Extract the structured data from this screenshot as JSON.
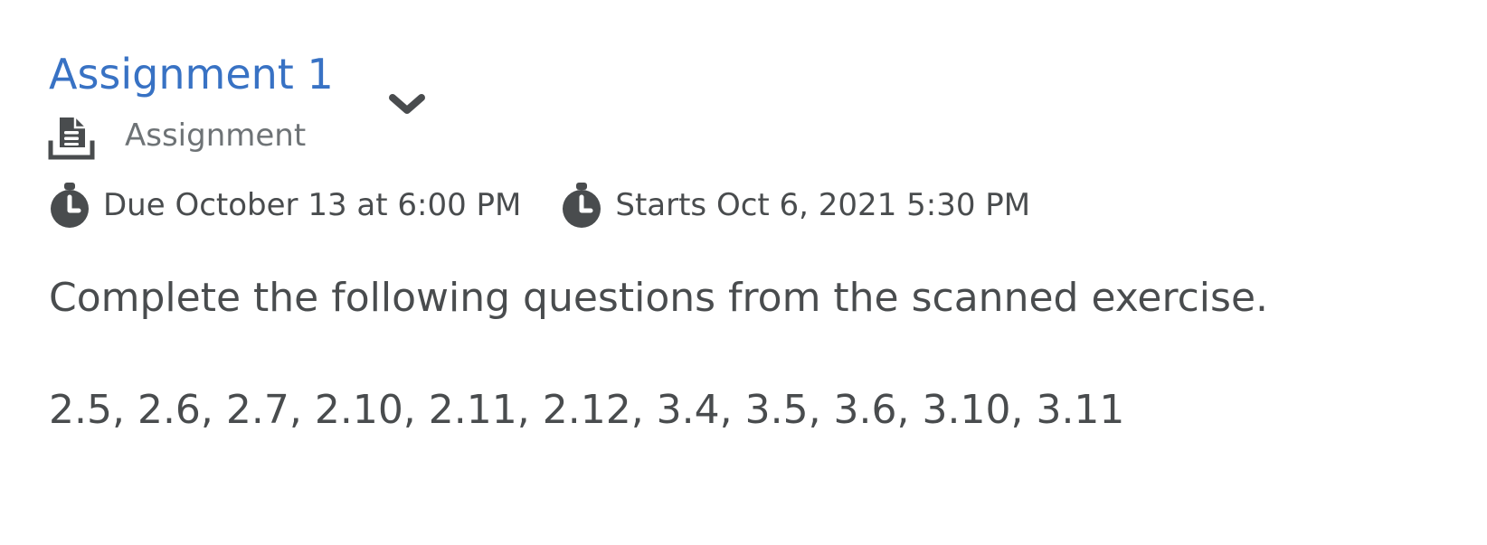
{
  "assignment": {
    "title": "Assignment 1",
    "type_label": "Assignment",
    "due_text": "Due October 13 at 6:00 PM",
    "start_text": "Starts Oct 6, 2021 5:30 PM",
    "description": [
      "Complete the following questions from the scanned exercise.",
      "2.5, 2.6, 2.7, 2.10, 2.11, 2.12, 3.4, 3.5, 3.6, 3.10, 3.11"
    ]
  },
  "icons": {
    "expand": "chevron-down-icon",
    "type": "assignment-icon",
    "due": "clock-icon",
    "start": "clock-icon"
  },
  "colors": {
    "title": "#3872c4",
    "text": "#494c4e",
    "muted": "#6e7376",
    "icon": "#494c4e"
  }
}
